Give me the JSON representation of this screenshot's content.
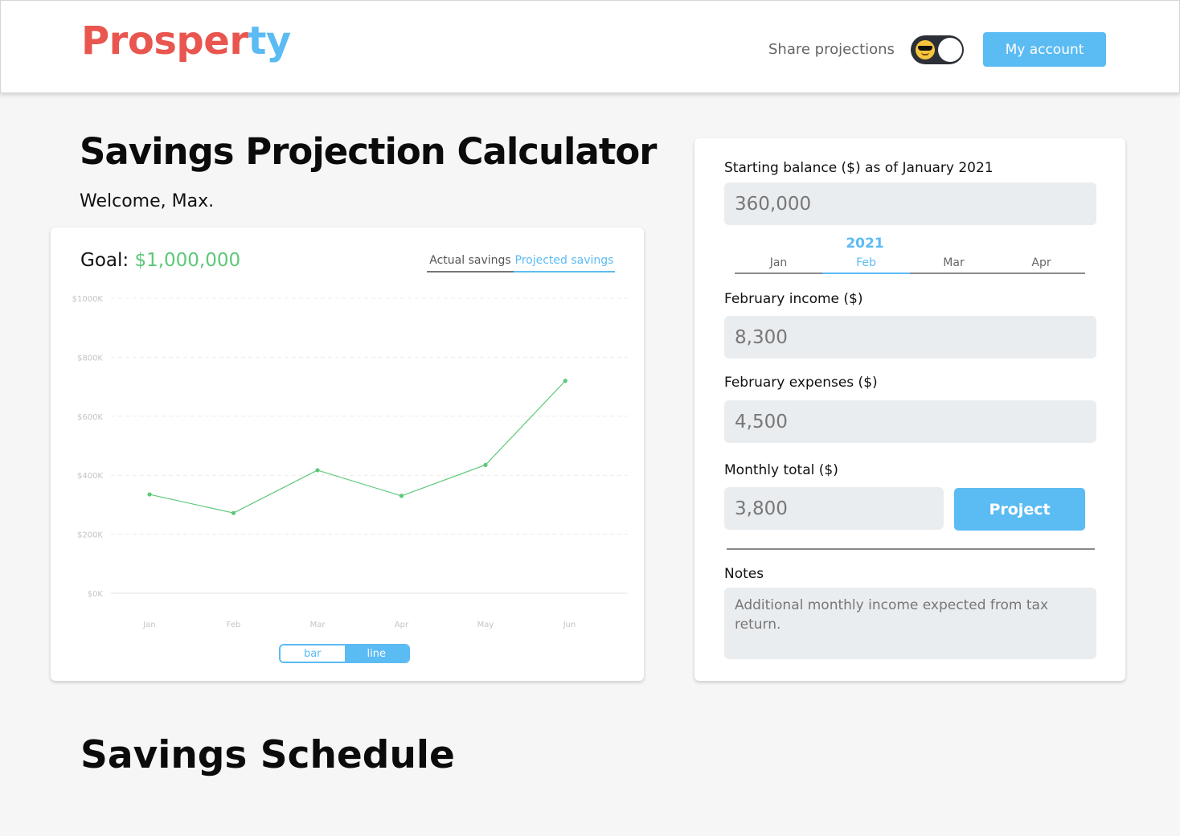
{
  "header": {
    "logo_part1": "Prosper",
    "logo_part2": "ty",
    "share_label": "Share projections",
    "account_button": "My account",
    "toggle_on": true
  },
  "page": {
    "title": "Savings Projection Calculator",
    "welcome": "Welcome, Max."
  },
  "chart_card": {
    "goal_label": "Goal:",
    "goal_amount": "$1,000,000",
    "tabs": {
      "actual": "Actual savings",
      "projected": "Projected savings",
      "selected": "projected"
    },
    "view_toggle": {
      "bar": "bar",
      "line": "line",
      "selected": "line"
    }
  },
  "chart_data": {
    "type": "line",
    "title": "",
    "xlabel": "",
    "ylabel": "",
    "ylim": [
      0,
      1000
    ],
    "y_ticks": [
      "$0K",
      "$200K",
      "$400K",
      "$600K",
      "$800K",
      "$1000K"
    ],
    "y_tick_values": [
      0,
      200,
      400,
      600,
      800,
      1000
    ],
    "x_ticks": [
      "Jan",
      "Feb",
      "Mar",
      "Apr",
      "May",
      "Jun"
    ],
    "grid": true,
    "color": "#5cc878",
    "series": [
      {
        "x": [
          0,
          1,
          2,
          3,
          4,
          4.95
        ],
        "values": [
          335,
          272,
          417,
          330,
          435,
          720
        ]
      }
    ]
  },
  "form": {
    "starting_balance_label": "Starting balance ($) as of January 2021",
    "starting_balance_value": "360,000",
    "year": "2021",
    "months": [
      "Jan",
      "Feb",
      "Mar",
      "Apr"
    ],
    "selected_month": "Feb",
    "income_label": "February income ($)",
    "income_value": "8,300",
    "expenses_label": "February expenses ($)",
    "expenses_value": "4,500",
    "monthly_total_label": "Monthly total ($)",
    "monthly_total_value": "3,800",
    "project_button": "Project",
    "notes_label": "Notes",
    "notes_value": "Additional monthly income expected from tax return."
  },
  "schedule": {
    "title": "Savings Schedule"
  },
  "colors": {
    "brand_red": "#e8564f",
    "brand_blue": "#5bbbf3",
    "goal_green": "#5cc878"
  }
}
